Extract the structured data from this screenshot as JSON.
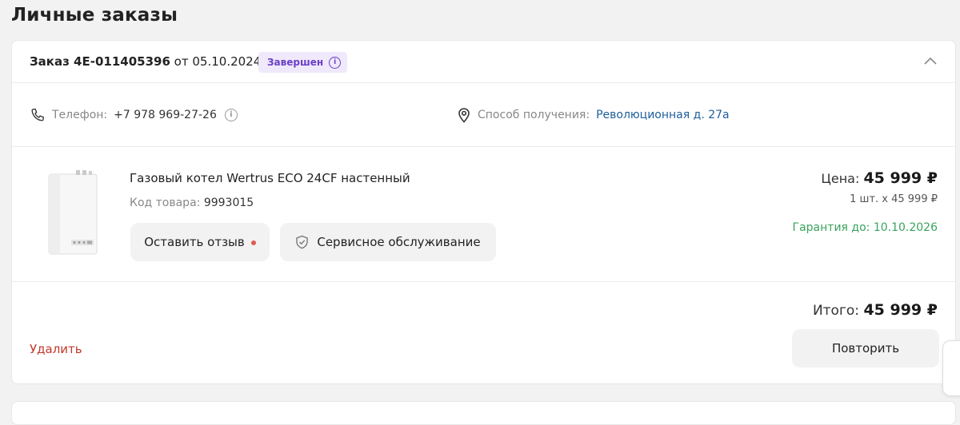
{
  "page": {
    "title": "Личные заказы"
  },
  "order": {
    "label_prefix": "Заказ",
    "number": "4E-011405396",
    "date_prefix": "от",
    "date": "05.10.2024",
    "status": "Завершен",
    "contacts": {
      "phone_label": "Телефон:",
      "phone_value": "+7 978 969-27-26",
      "delivery_label": "Способ получения:",
      "delivery_value": "Революционная д. 27а"
    },
    "item": {
      "name": "Газовый котел Wertrus ECO 24CF настенный",
      "sku_label": "Код товара:",
      "sku_value": "9993015",
      "review_button": "Оставить отзыв",
      "service_button": "Сервисное обслуживание",
      "price_label": "Цена:",
      "price_value": "45 999 ₽",
      "qty_text": "1 шт. х 45 999 ₽",
      "warranty_label": "Гарантия до:",
      "warranty_date": "10.10.2026"
    },
    "total_label": "Итого:",
    "total_value": "45 999 ₽",
    "delete_label": "Удалить",
    "repeat_button": "Повторить"
  },
  "colors": {
    "status_bg": "#efe9fb",
    "status_text": "#6b3fc9",
    "link": "#1d5e9b",
    "warranty": "#3aa35d",
    "delete": "#c0392b",
    "review_dot": "#e05a4f"
  }
}
